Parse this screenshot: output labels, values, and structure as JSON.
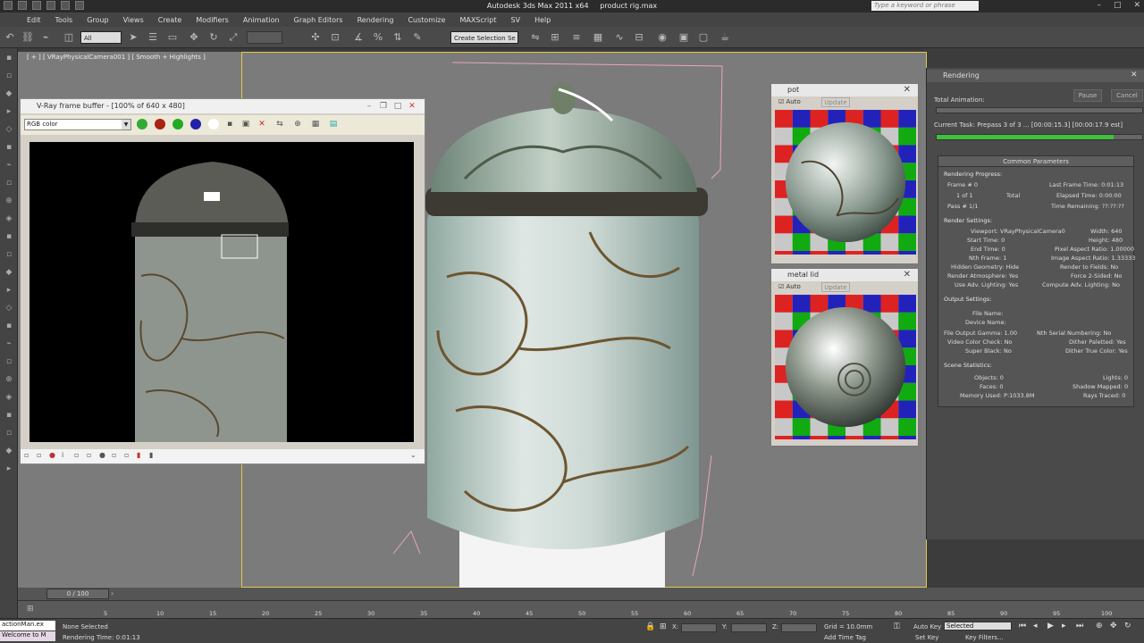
{
  "window": {
    "title": "Autodesk 3ds Max  2011 x64",
    "file": "product rig.max",
    "search_placeholder": "Type a keyword or phrase"
  },
  "menu": [
    "Edit",
    "Tools",
    "Group",
    "Views",
    "Create",
    "Modifiers",
    "Animation",
    "Graph Editors",
    "Rendering",
    "Customize",
    "MAXScript",
    "SV",
    "Help"
  ],
  "toolbar": {
    "filter": "All",
    "selection_set": "Create Selection Se"
  },
  "viewport": {
    "label": "[ + ] [ VRayPhysicalCamera001 ] [ Smooth + Highlights ]"
  },
  "vfb": {
    "title": "V-Ray frame buffer - [100% of 640 x 480]",
    "channel": "RGB color"
  },
  "materials": [
    {
      "name": "pot",
      "auto": "Auto",
      "update": "Update"
    },
    {
      "name": "metal lid",
      "auto": "Auto",
      "update": "Update"
    }
  ],
  "render": {
    "title": "Rendering",
    "pause": "Pause",
    "cancel": "Cancel",
    "total_animation": "Total Animation:",
    "current_task": "Current Task:  Prepass 3 of 3 ...  [00:00:15.3] [00:00:17.9 est]",
    "total_progress": 0,
    "task_progress": 0.86,
    "common_parameters": "Common Parameters",
    "rendering_progress": "Rendering Progress:",
    "frame": "Frame #  0",
    "frame_of": "1 of 1",
    "total": "Total",
    "pass": "Pass #  1/1",
    "last_frame_time": "Last Frame Time:  0:01:13",
    "elapsed_time": "Elapsed Time:  0:00:00",
    "time_remaining": "Time Remaining:  ??:??:??",
    "render_settings": "Render Settings:",
    "viewport": "Viewport:  VRayPhysicalCamera0",
    "width": "Width:  640",
    "start_time": "Start Time:  0",
    "height": "Height:  480",
    "end_time": "End Time:  0",
    "pixel_aspect": "Pixel Aspect Ratio:  1.00000",
    "nth_frame": "Nth Frame:  1",
    "image_aspect": "Image Aspect Ratio:  1.33333",
    "hidden_geometry": "Hidden Geometry:  Hide",
    "render_fields": "Render to Fields:  No",
    "render_atmos": "Render Atmosphere:  Yes",
    "force_2sided": "Force 2-Sided:  No",
    "adv_lighting": "Use Adv. Lighting:  Yes",
    "compute_adv": "Compute Adv. Lighting:  No",
    "output_settings": "Output Settings:",
    "file_name": "File Name:",
    "device_name": "Device Name:",
    "gamma": "File Output Gamma:  1.00",
    "nth_serial": "Nth Serial Numbering:  No",
    "video_color": "Video Color Check:  No",
    "dither_palette": "Dither Paletted:  Yes",
    "super_black": "Super Black:  No",
    "dither_true": "Dither True Color:  Yes",
    "scene_statistics": "Scene Statistics:",
    "objects": "Objects:  0",
    "lights": "Lights:  0",
    "faces": "Faces:  0",
    "shadow_mapped": "Shadow Mapped:  0",
    "memory": "Memory Used:  P:1033.8M",
    "rays_traced": "Rays Traced:  0"
  },
  "timeline": {
    "slider": "0 / 100",
    "ticks": [
      "5",
      "10",
      "15",
      "20",
      "25",
      "30",
      "35",
      "40",
      "45",
      "50",
      "55",
      "60",
      "65",
      "70",
      "75",
      "80",
      "85",
      "90",
      "95",
      "100"
    ]
  },
  "status": {
    "script_line1": "actionMan.ex",
    "script_line2": "Welcome to M",
    "selection": "None Selected",
    "render_time": "Rendering Time: 0:01:13",
    "grid": "Grid = 10.0mm",
    "auto_key": "Auto Key",
    "selected": "Selected",
    "set_key": "Set Key",
    "key_filters": "Key Filters...",
    "add_time_tag": "Add Time Tag",
    "x_label": "X:",
    "y_label": "Y:",
    "z_label": "Z:"
  }
}
